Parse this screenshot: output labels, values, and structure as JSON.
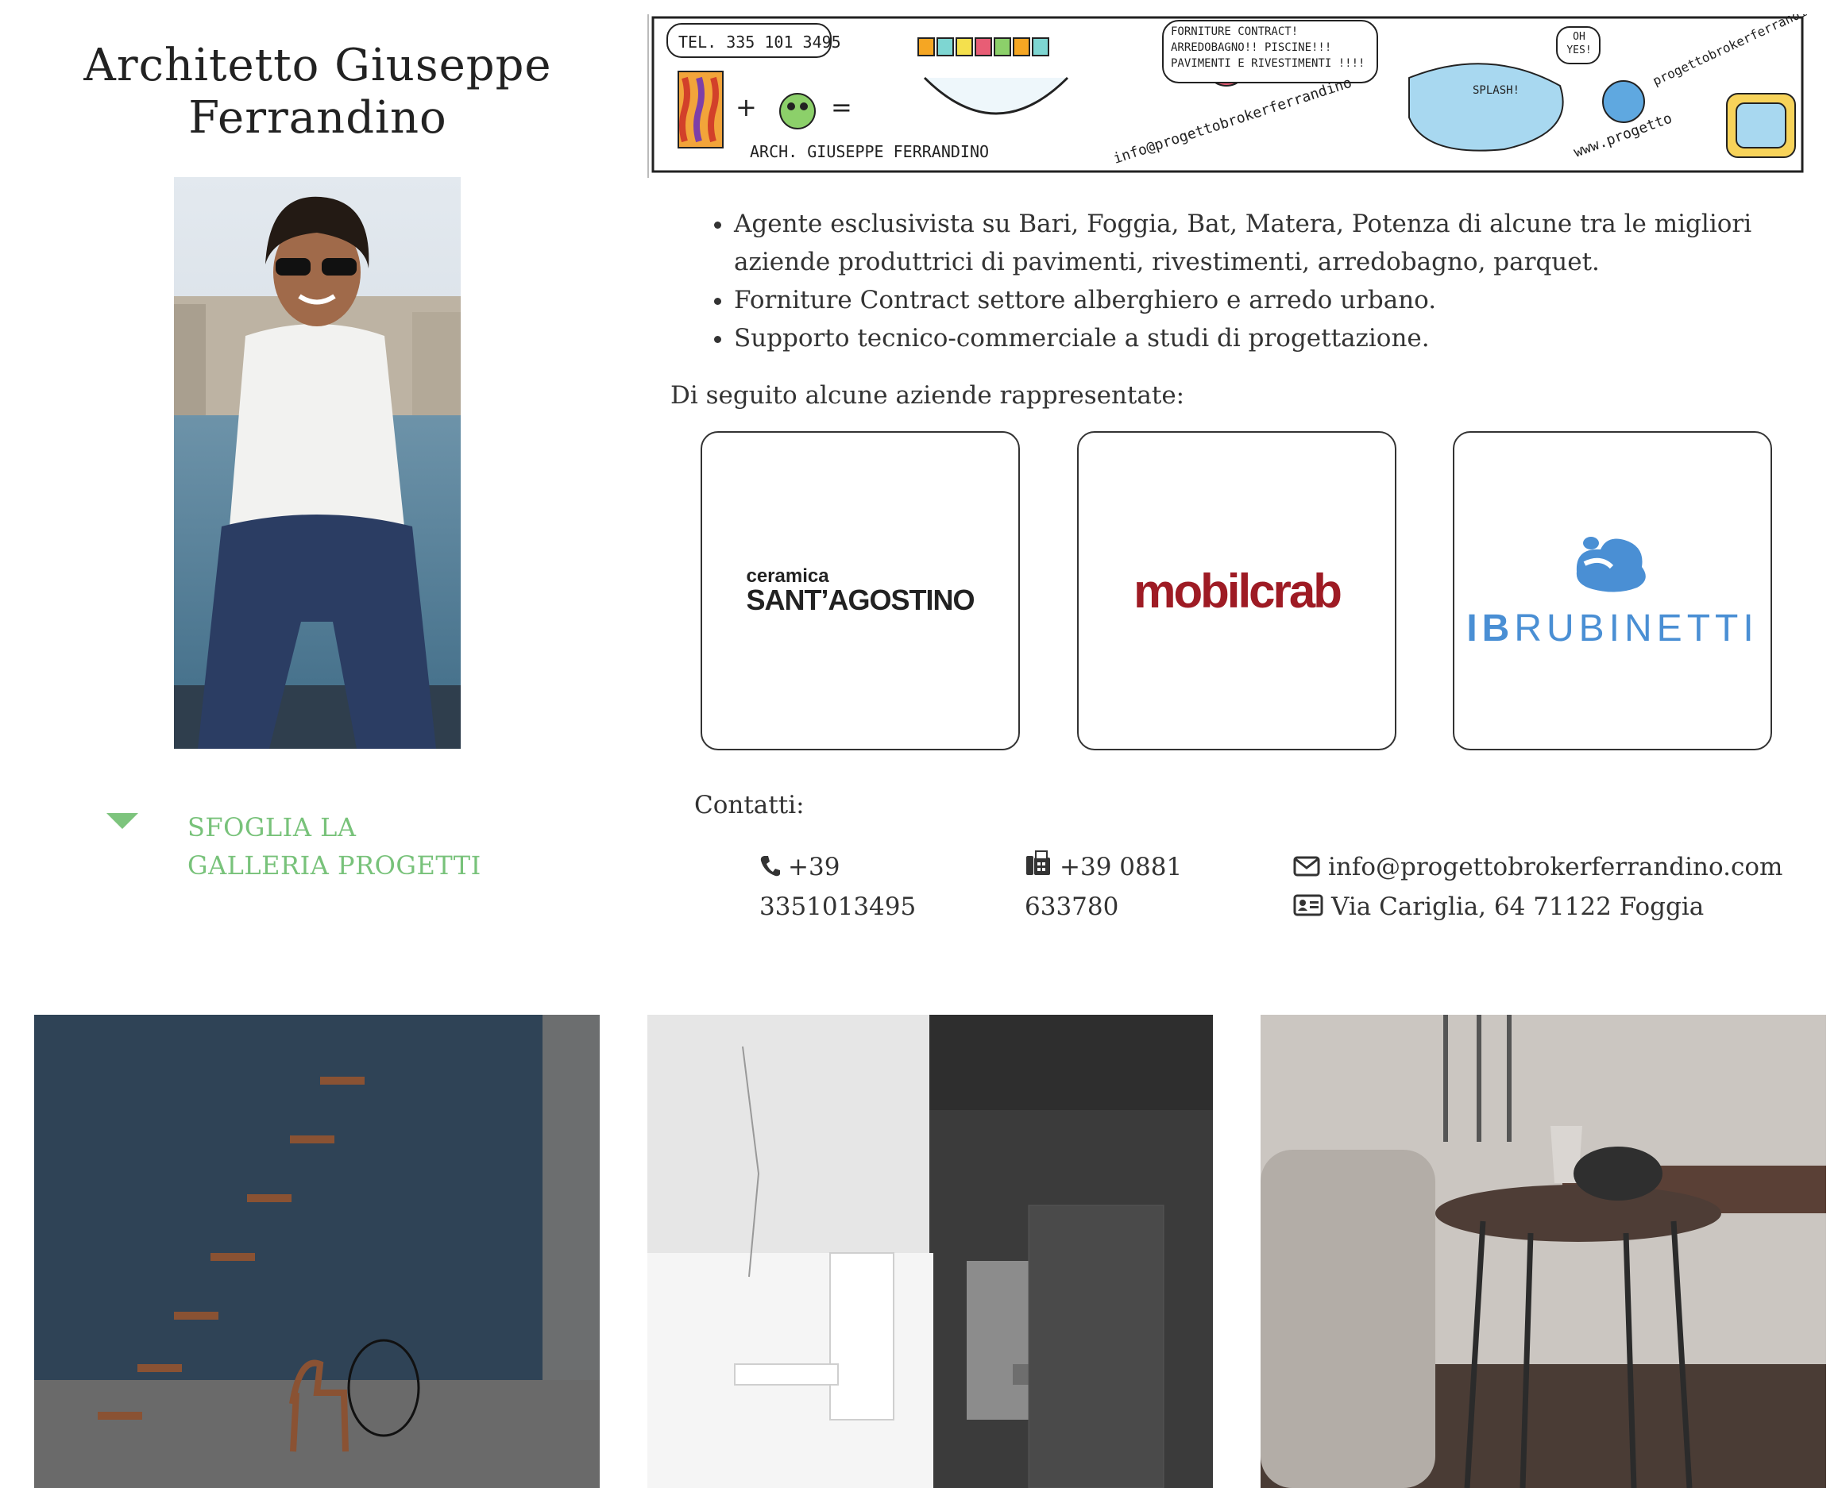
{
  "header": {
    "title": "Architetto Giuseppe Ferrandino"
  },
  "banner": {
    "phone": "TEL. 335 101 3495",
    "signature": "ARCH. GIUSEPPE FERRANDINO",
    "speech": "FORNITURE CONTRACT! ARREDOBAGNO!! PISCINE!!! PAVIMENTI E RIVESTIMENTI !!!!",
    "email": "info@progettobrokerferrandino",
    "splash": "SPLASH!",
    "oh_yes": "OH YES!",
    "site1": "progettobrokerferrandino.com",
    "site2": "www.progetto"
  },
  "sidebar": {
    "gallery_link": "SFOGLIA LA GALLERIA PROGETTI"
  },
  "info": {
    "bullets": [
      "Agente esclusivista su Bari, Foggia, Bat, Matera, Potenza di alcune tra le migliori aziende produttrici di pavimenti, rivestimenti, arredobagno, parquet.",
      "Forniture Contract settore alberghiero e arredo urbano.",
      "Supporto tecnico-commerciale a studi di progettazione."
    ],
    "reps_heading": "Di seguito alcune aziende rappresentate:"
  },
  "brands": [
    {
      "line1": "ceramica",
      "line2": "SANT’AGOSTINO"
    },
    {
      "name": "mobilcrab"
    },
    {
      "name_bold": "IB",
      "name_light": "RUBINETTI"
    }
  ],
  "contacts": {
    "heading": "Contatti:",
    "phone": "+39 3351013495",
    "fax": "+39 0881 633780",
    "email": "info@progettobrokerferrandino.com",
    "address": "Via Cariglia, 64 71122 Foggia"
  },
  "colors": {
    "accent_green": "#78c27a",
    "text": "#333333",
    "mobilcrab_red": "#9e1b24",
    "ib_blue": "#4a8fd4"
  }
}
